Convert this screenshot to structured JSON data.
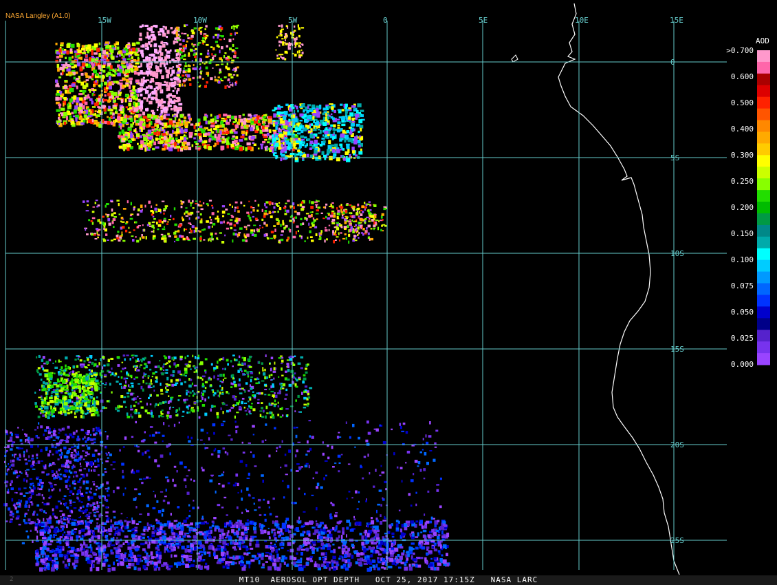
{
  "credit": "NASA Langley (A1.0)",
  "footer": {
    "caption": "MT10  AEROSOL OPT DEPTH   OCT 25, 2017 17:15Z   NASA LARC",
    "frame": "2"
  },
  "legend": {
    "title": "AOD",
    "labels": [
      ">0.700",
      "0.600",
      "0.500",
      "0.400",
      "0.300",
      "0.250",
      "0.200",
      "0.150",
      "0.100",
      "0.075",
      "0.050",
      "0.025",
      "0.000"
    ],
    "colors": [
      "#ff99cc",
      "#ff66aa",
      "#aa0000",
      "#dd0000",
      "#ff2200",
      "#ff5500",
      "#ff8800",
      "#ffaa00",
      "#ffcc00",
      "#ffff00",
      "#ccff00",
      "#88ff00",
      "#22dd00",
      "#00bb00",
      "#009944",
      "#008888",
      "#00aaaa",
      "#00ffff",
      "#00ccff",
      "#0099ff",
      "#0066ff",
      "#0033ff",
      "#0000cc",
      "#000088",
      "#5522cc",
      "#7733ee",
      "#9944ff"
    ]
  },
  "grid": {
    "lon_labels": [
      "15W",
      "10W",
      "5W",
      "0",
      "5E",
      "10E",
      "15E"
    ],
    "lat_labels": [
      "0",
      "5S",
      "10S",
      "15S",
      "20S",
      "25S"
    ]
  },
  "layers": {
    "coastline_color": "#ffffff",
    "gridline_color": "#66cccc"
  }
}
